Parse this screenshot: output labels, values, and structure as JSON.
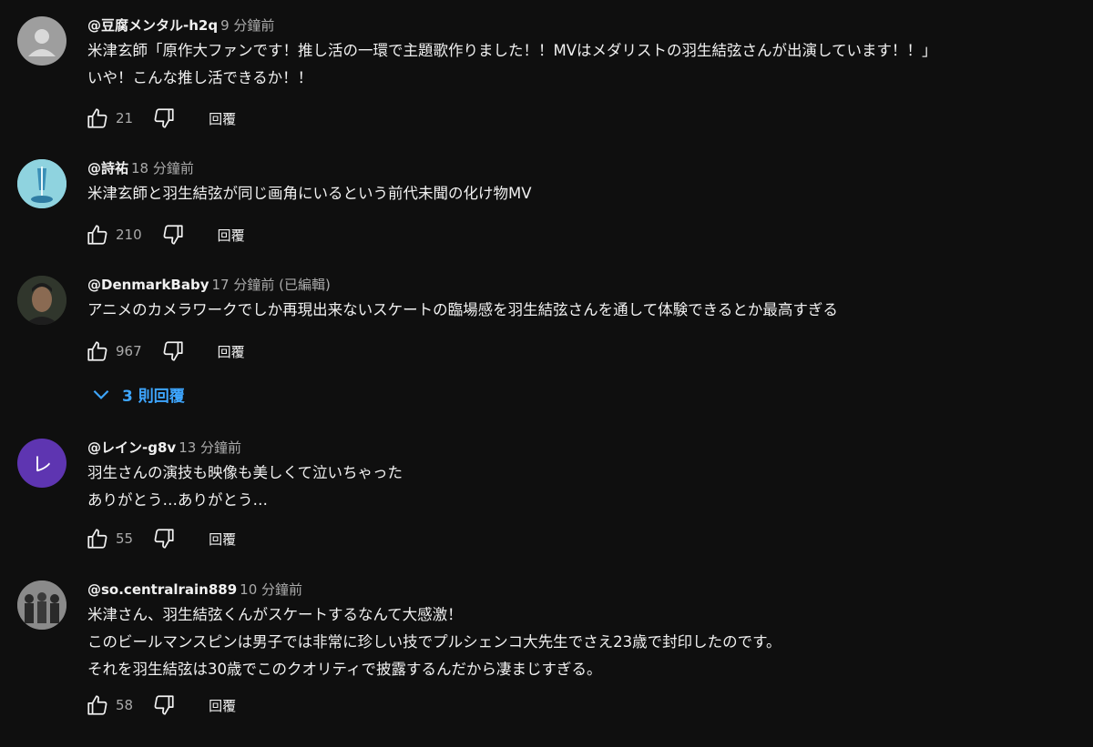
{
  "actions": {
    "reply_label": "回覆"
  },
  "comments": [
    {
      "author": "@豆腐メンタル-h2q",
      "time": "9 分鐘前",
      "lines": [
        "米津玄師「原作大ファンです！推し活の一環で主題歌作りました！！MVはメダリストの羽生結弦さんが出演しています！！」",
        "いや！こんな推し活できるか！！"
      ],
      "likes": "21",
      "avatar": "default-person-icon"
    },
    {
      "author": "@詩祐",
      "time": "18 分鐘前",
      "lines": [
        "米津玄師と羽生結弦が同じ画角にいるという前代未聞の化け物MV"
      ],
      "likes": "210",
      "avatar": "ice-sculpture-photo"
    },
    {
      "author": "@DenmarkBaby",
      "time": "17 分鐘前 (已編輯)",
      "lines": [
        "アニメのカメラワークでしか再現出来ないスケートの臨場感を羽生結弦さんを通して体験できるとか最高すぎる"
      ],
      "likes": "967",
      "avatar": "man-portrait-photo",
      "replies_label": "3 則回覆"
    },
    {
      "author": "@レイン-g8v",
      "time": "13 分鐘前",
      "lines": [
        "羽生さんの演技も映像も美しくて泣いちゃった",
        "ありがとう…ありがとう…"
      ],
      "likes": "55",
      "avatar": "letter-avatar",
      "avatar_letter": "レ",
      "avatar_color": "#5e35b1"
    },
    {
      "author": "@so.centralrain889",
      "time": "10 分鐘前",
      "lines": [
        "米津さん、羽生結弦くんがスケートするなんて大感激！",
        "このビールマンスピンは男子では非常に珍しい技でプルシェンコ大先生でさえ23歳で封印したのです。",
        "それを羽生結弦は30歳でこのクオリティで披露するんだから凄まじすぎる。"
      ],
      "likes": "58",
      "avatar": "group-photo"
    }
  ]
}
